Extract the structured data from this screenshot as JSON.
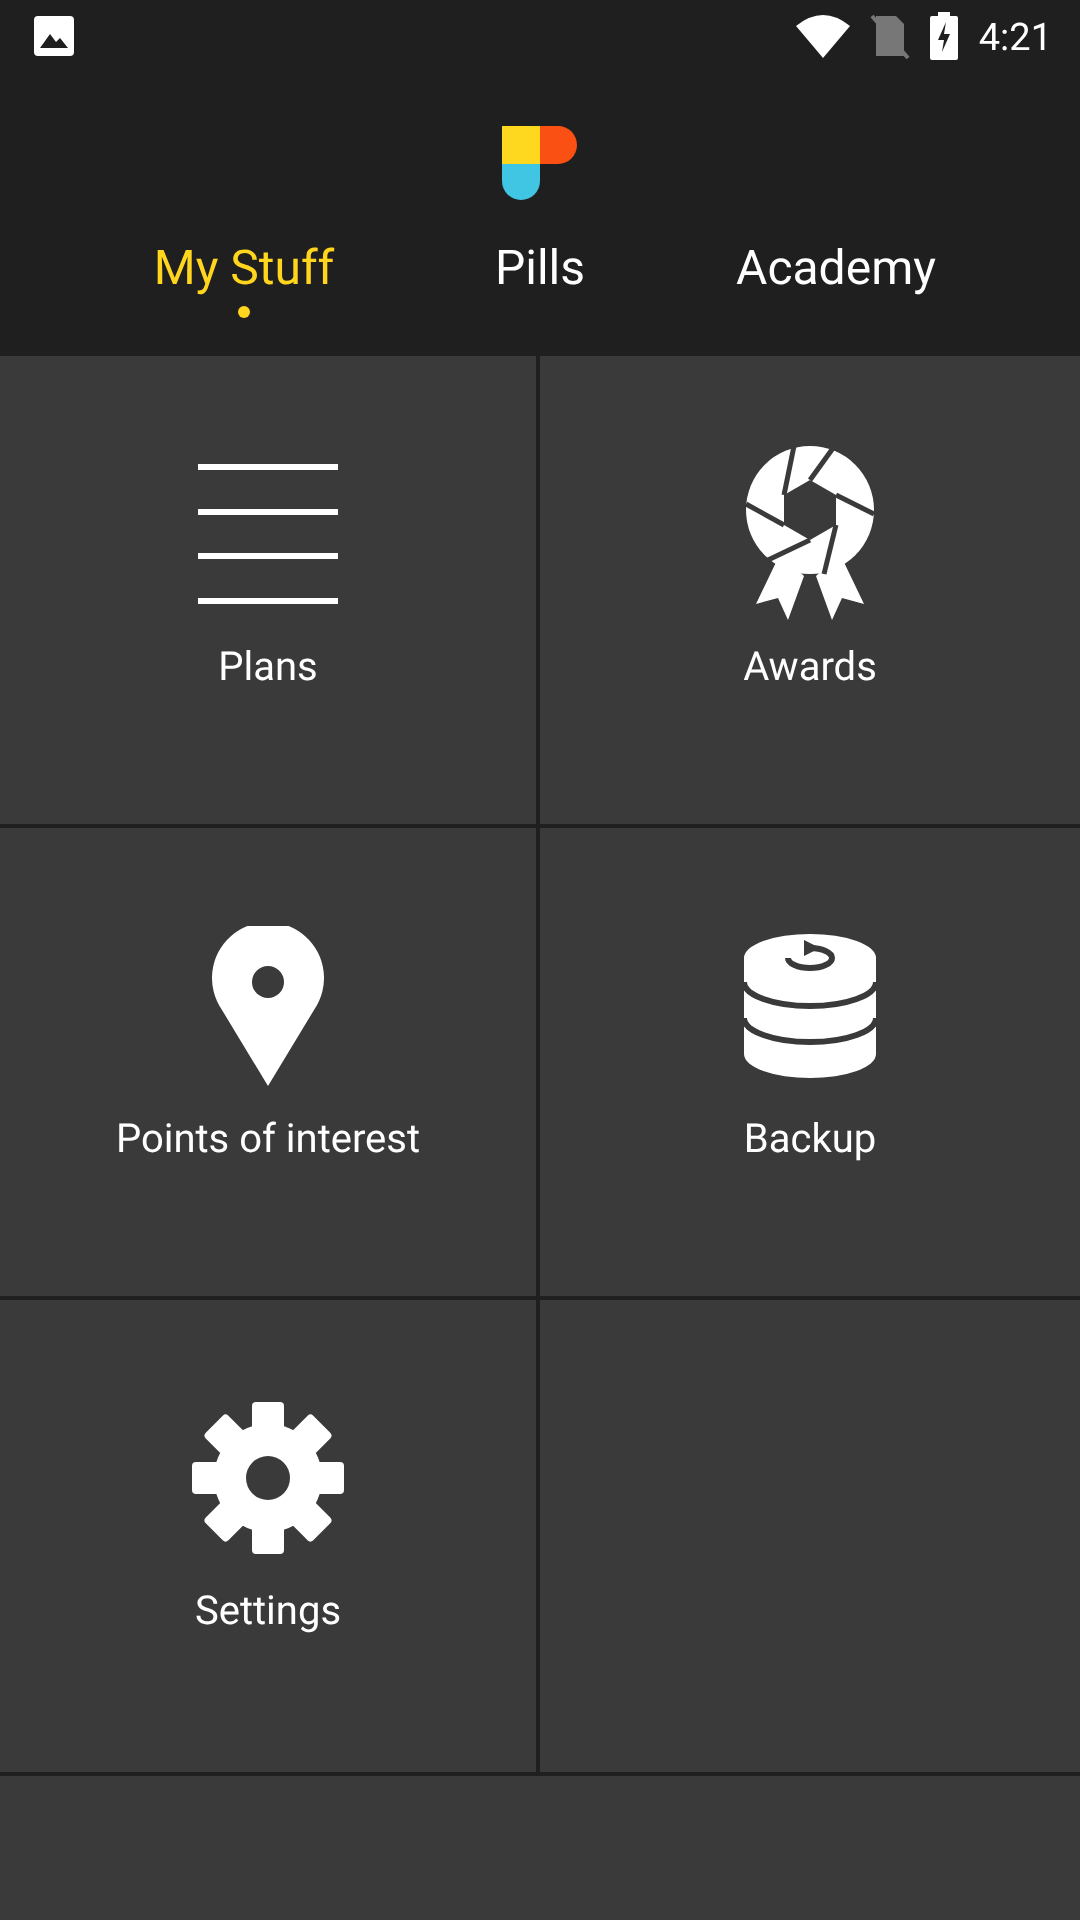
{
  "status_bar": {
    "time": "4:21"
  },
  "tabs": [
    {
      "label": "My Stuff",
      "selected": true
    },
    {
      "label": "Pills",
      "selected": false
    },
    {
      "label": "Academy",
      "selected": false
    }
  ],
  "tiles": [
    {
      "label": "Plans",
      "kind": "plans"
    },
    {
      "label": "Awards",
      "kind": "awards"
    },
    {
      "label": "Points of interest",
      "kind": "poi"
    },
    {
      "label": "Backup",
      "kind": "backup"
    },
    {
      "label": "Settings",
      "kind": "settings"
    }
  ]
}
